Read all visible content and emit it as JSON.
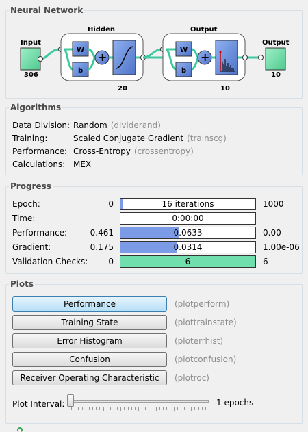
{
  "network": {
    "title": "Neural Network",
    "input_label": "Input",
    "input_size": "306",
    "hidden_label": "Hidden",
    "hidden_size": "20",
    "output_layer_label": "Output",
    "output_layer_size": "10",
    "output_label": "Output",
    "output_size": "10",
    "w_label": "W",
    "b_label": "b"
  },
  "algorithms": {
    "title": "Algorithms",
    "rows": [
      {
        "label": "Data Division:",
        "value": "Random",
        "fn": "(dividerand)"
      },
      {
        "label": "Training:",
        "value": "Scaled Conjugate Gradient",
        "fn": "(trainscg)"
      },
      {
        "label": "Performance:",
        "value": "Cross-Entropy",
        "fn": "(crossentropy)"
      },
      {
        "label": "Calculations:",
        "value": "MEX",
        "fn": ""
      }
    ]
  },
  "progress": {
    "title": "Progress",
    "rows": [
      {
        "label": "Epoch:",
        "start": "0",
        "bar_text": "16 iterations",
        "end": "1000",
        "fill_fraction": 0.016,
        "color": "#7b9be6"
      },
      {
        "label": "Time:",
        "start": "",
        "bar_text": "0:00:00",
        "end": "",
        "fill_fraction": 0,
        "color": "#7b9be6"
      },
      {
        "label": "Performance:",
        "start": "0.461",
        "bar_text": "0.0633",
        "end": "0.00",
        "fill_fraction": 0.43,
        "color": "#7b9be6"
      },
      {
        "label": "Gradient:",
        "start": "0.175",
        "bar_text": "0.0314",
        "end": "1.00e-06",
        "fill_fraction": 0.42,
        "color": "#7b9be6"
      },
      {
        "label": "Validation Checks:",
        "start": "0",
        "bar_text": "6",
        "end": "6",
        "fill_fraction": 1.0,
        "color": "#70dfad"
      }
    ]
  },
  "plots": {
    "title": "Plots",
    "buttons": [
      {
        "label": "Performance",
        "fn": "(plotperform)"
      },
      {
        "label": "Training State",
        "fn": "(plottrainstate)"
      },
      {
        "label": "Error Histogram",
        "fn": "(ploterrhist)"
      },
      {
        "label": "Confusion",
        "fn": "(plotconfusion)"
      },
      {
        "label": "Receiver Operating Characteristic",
        "fn": "(plotroc)"
      }
    ],
    "interval_label": "Plot Interval:",
    "interval_value": "1 epochs"
  },
  "colors": {
    "layer_box": "#6f93df",
    "io_box": "#72e0ac",
    "connection": "#3ec9a0"
  }
}
